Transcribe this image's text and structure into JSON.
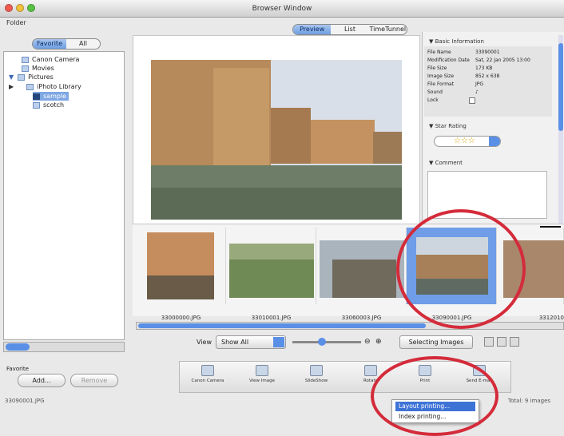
{
  "window": {
    "title": "Browser Window"
  },
  "left": {
    "folder_label": "Folder",
    "seg": [
      "Favorite",
      "All"
    ],
    "tree": [
      "Canon Camera",
      "Movies",
      "Pictures",
      "iPhoto Library",
      "sample",
      "scotch"
    ],
    "favorite_label": "Favorite",
    "add_label": "Add...",
    "remove_label": "Remove"
  },
  "view_tabs": [
    "Preview",
    "List",
    "TimeTunnel"
  ],
  "info": {
    "basic_header": "Basic Information",
    "rows": [
      {
        "k": "File Name",
        "v": "33090001"
      },
      {
        "k": "Modification Date",
        "v": "Sat, 22 Jan 2005 13:00"
      },
      {
        "k": "File Size",
        "v": "173 KB"
      },
      {
        "k": "Image Size",
        "v": "852 x 638"
      },
      {
        "k": "File Format",
        "v": "JPG"
      },
      {
        "k": "Sound",
        "v": ""
      },
      {
        "k": "Lock",
        "v": ""
      }
    ],
    "star_header": "Star Rating",
    "stars": "☆☆☆",
    "comment_header": "Comment"
  },
  "thumbnails": [
    "33000000.JPG",
    "33010001.JPG",
    "33060003.JPG",
    "33090001.JPG",
    "3312010"
  ],
  "toolbar": {
    "view_label": "View",
    "view_select": "Show All",
    "selecting_label": "Selecting Images"
  },
  "bottom_tools": [
    "Canon Camera",
    "View Image",
    "SlideShow",
    "Rotate",
    "Print",
    "Send E-mail"
  ],
  "menu": [
    "Layout printing...",
    "Index printing..."
  ],
  "status_left": "33090001.JPG",
  "status_right": "Total: 9 images",
  "colors": {
    "highlight": "#5a8fe6",
    "circle": "#d42b3a"
  }
}
